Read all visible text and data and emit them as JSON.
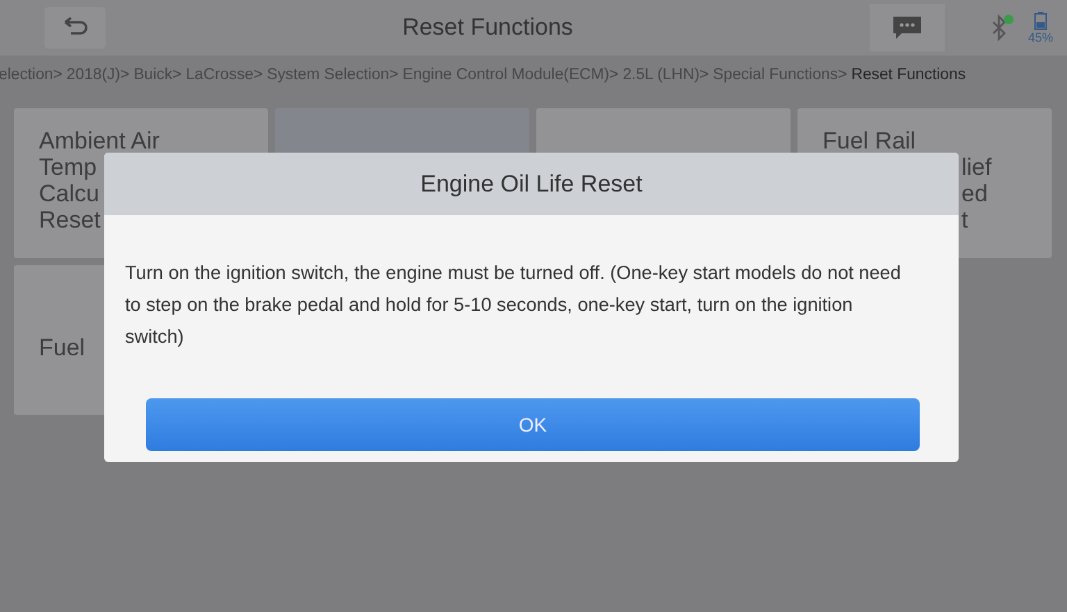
{
  "header": {
    "title": "Reset Functions",
    "battery": "45%"
  },
  "breadcrumb": [
    {
      "label": "election>",
      "current": false
    },
    {
      "label": "2018(J)>",
      "current": false
    },
    {
      "label": "Buick>",
      "current": false
    },
    {
      "label": "LaCrosse>",
      "current": false
    },
    {
      "label": "System Selection>",
      "current": false
    },
    {
      "label": "Engine Control Module(ECM)>",
      "current": false
    },
    {
      "label": "2.5L (LHN)>",
      "current": false
    },
    {
      "label": "Special Functions>",
      "current": false
    },
    {
      "label": "Reset Functions",
      "current": true
    }
  ],
  "tiles": [
    {
      "selected": false,
      "lines": [
        {
          "kind": "head",
          "text": "Ambient Air"
        },
        {
          "kind": "head",
          "text": "Temp"
        },
        {
          "kind": "head",
          "text": "Calcu"
        },
        {
          "kind": "head",
          "text": "Reset"
        }
      ]
    },
    {
      "selected": true
    },
    {
      "selected": false
    },
    {
      "selected": false,
      "lines": [
        {
          "kind": "head",
          "text": "Fuel Rail"
        },
        {
          "kind": "tail",
          "text": "lief"
        },
        {
          "kind": "tail",
          "text": "ed"
        },
        {
          "kind": "tail",
          "text": "t"
        }
      ]
    },
    {
      "selected": false,
      "lines": [
        {
          "kind": "mid",
          "text": "Fuel"
        }
      ]
    }
  ],
  "dialog": {
    "title": "Engine Oil Life Reset",
    "message": "Turn on the ignition switch, the engine must be turned off. (One-key start models do not need to step on the brake pedal and hold for 5-10 seconds, one-key start, turn on the ignition switch)",
    "button": "OK"
  }
}
